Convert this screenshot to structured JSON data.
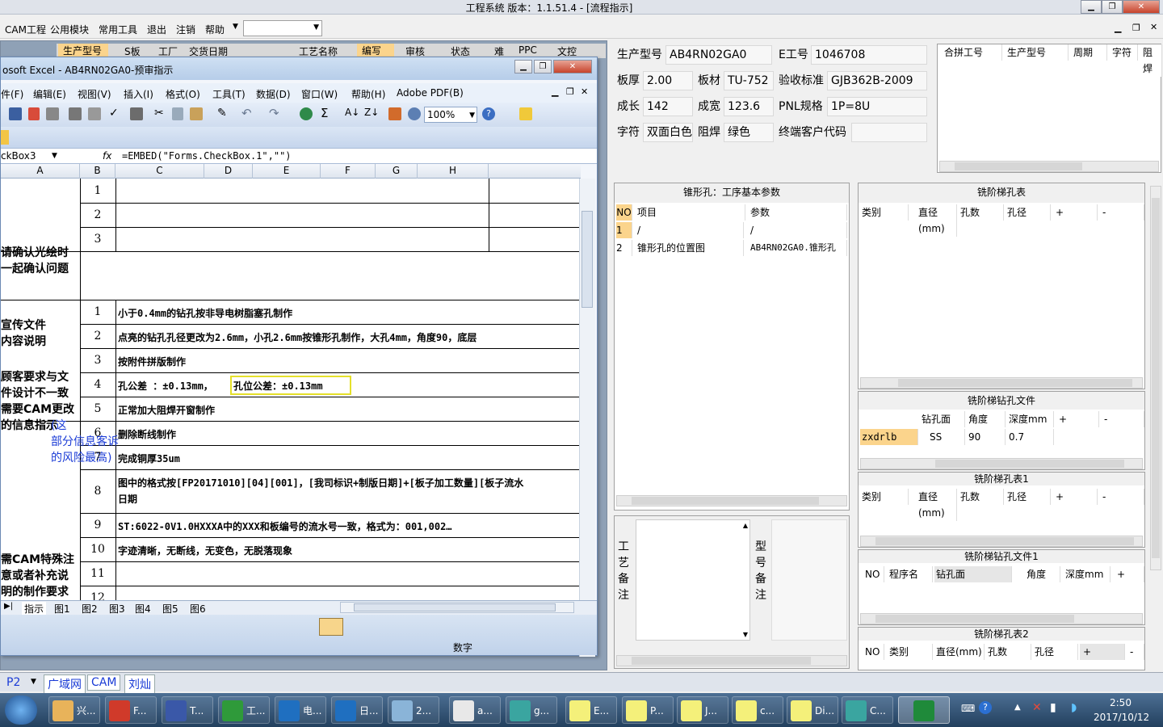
{
  "app": {
    "title": "工程系统   版本：1.1.51.4 - [流程指示]"
  },
  "menubar": {
    "items": [
      "CAM工程",
      "公用模块",
      "常用工具",
      "退出",
      "注销",
      "帮助"
    ]
  },
  "behind_tabs": [
    "生产型号",
    "S板",
    "工厂",
    "交货日期",
    "工艺名称",
    "编写",
    "审核",
    "状态",
    "难",
    "PPC",
    "文控"
  ],
  "excel": {
    "title": "osoft Excel - AB4RN02GA0-预审指示",
    "menu": [
      "件(F)",
      "编辑(E)",
      "视图(V)",
      "插入(I)",
      "格式(O)",
      "工具(T)",
      "数据(D)",
      "窗口(W)",
      "帮助(H)",
      "Adobe PDF(B)"
    ],
    "zoom": "100%",
    "namebox": "ckBox3",
    "fx": "fx",
    "formula": "=EMBED(\"Forms.CheckBox.1\",\"\")",
    "columns": [
      "A",
      "B",
      "C",
      "D",
      "E",
      "F",
      "G",
      "H"
    ],
    "labels": {
      "l1": "请确认光绘时\n一起确认问题",
      "l2": "宣传文件\n内容说明",
      "l3": "顾客要求与文\n件设计不一致\n需要CAM更改\n的信息指示",
      "l3b": "(这\n部分信息客诉\n的风险最高)",
      "l4": "需CAM特殊注\n意或者补充说\n明的制作要求"
    },
    "rows": [
      {
        "no": "1",
        "text": ""
      },
      {
        "no": "2",
        "text": ""
      },
      {
        "no": "3",
        "text": ""
      },
      {
        "no": "1",
        "text": "小于0.4mm的钻孔按非导电树脂塞孔制作"
      },
      {
        "no": "2",
        "text": "点亮的钻孔孔径更改为2.6mm，小孔2.6mm按锥形孔制作，大孔4mm，角度90，底层"
      },
      {
        "no": "3",
        "text": "按附件拼版制作"
      },
      {
        "no": "4",
        "text": "孔公差 ：±0.13mm，",
        "highlight": "孔位公差：±0.13mm"
      },
      {
        "no": "5",
        "text": "正常加大阻焊开窗制作"
      },
      {
        "no": "6",
        "text": "删除断线制作"
      },
      {
        "no": "7",
        "text": "完成铜厚35um"
      },
      {
        "no": "8",
        "text": "图中的格式按[FP20171010][04][001]，[我司标识+制版日期]+[板子加工数量][板子流水",
        "text2": "日期"
      },
      {
        "no": "9",
        "text": "ST:6022-0V1.0HXXXA中的XXX和板编号的流水号一致，格式为：001,002…"
      },
      {
        "no": "10",
        "text": "字迹清晰，无断线，无变色，无脱落现象"
      },
      {
        "no": "11",
        "text": ""
      },
      {
        "no": "12",
        "text": ""
      }
    ],
    "sheets": [
      "指示",
      "图1",
      "图2",
      "图3",
      "图4",
      "图5",
      "图6"
    ],
    "status": "数字"
  },
  "info": {
    "生产型号": "AB4RN02GA0",
    "E工号": "1046708",
    "板厚": "2.00",
    "板材": "TU-752",
    "验收标准": "GJB362B-2009",
    "成长": "142",
    "成宽": "123.6",
    "PNL规格": "1P=8U",
    "字符": "双面白色",
    "阻焊": "绿色",
    "终端客户代码": ""
  },
  "merge_table": {
    "headers": [
      "合拼工号",
      "生产型号",
      "周期",
      "字符",
      "阻焊"
    ]
  },
  "countersink": {
    "title": "锥形孔：工序基本参数",
    "headers": [
      "NO",
      "项目",
      "参数"
    ],
    "rows": [
      [
        "1",
        "/",
        "/"
      ],
      [
        "2",
        "锥形孔的位置图",
        "AB4RN02GA0.锥形孔"
      ]
    ]
  },
  "notes": {
    "left": "工艺备注",
    "right": "型号备注"
  },
  "step_table": {
    "title": "铣阶梯孔表",
    "headers": [
      "类别",
      "直径(mm)",
      "孔数",
      "孔径",
      "+",
      "-"
    ]
  },
  "step_drill": {
    "title": "铣阶梯钻孔文件",
    "headers": [
      "钻孔面",
      "角度",
      "深度mm",
      "+",
      "-"
    ],
    "row": [
      "zxdrlb",
      "SS",
      "90",
      "0.7"
    ]
  },
  "step_table1": {
    "title": "铣阶梯孔表1",
    "headers": [
      "类别",
      "直径(mm)",
      "孔数",
      "孔径",
      "+",
      "-"
    ]
  },
  "step_drill1": {
    "title": "铣阶梯钻孔文件1",
    "headers": [
      "NO",
      "程序名",
      "钻孔面",
      "角度",
      "深度mm",
      "+"
    ]
  },
  "step_table2": {
    "title": "铣阶梯孔表2",
    "headers": [
      "NO",
      "类别",
      "直径(mm)",
      "孔数",
      "孔径",
      "+",
      "-"
    ]
  },
  "bottom_tabs": {
    "p": "P2",
    "items": [
      "广域网",
      "CAM",
      "刘灿"
    ]
  },
  "taskbar": {
    "items": [
      "兴...",
      "F...",
      "T...",
      "工...",
      "电...",
      "日...",
      "2...",
      "a...",
      "g...",
      "E...",
      "P...",
      "J...",
      "c...",
      "Di...",
      "C..."
    ],
    "time": "2:50",
    "date": "2017/10/12"
  }
}
